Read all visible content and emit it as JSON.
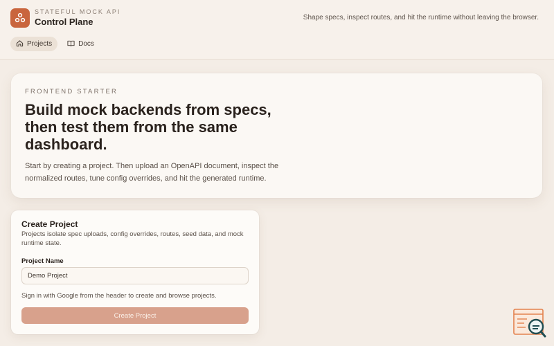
{
  "header": {
    "kicker": "STATEFUL MOCK API",
    "title": "Control Plane",
    "tagline": "Shape specs, inspect routes, and hit the runtime without leaving the browser.",
    "logo_icon": "network-nodes-icon"
  },
  "nav": {
    "items": [
      {
        "label": "Projects",
        "icon": "home-icon",
        "active": true
      },
      {
        "label": "Docs",
        "icon": "book-icon",
        "active": false
      }
    ]
  },
  "hero": {
    "kicker": "FRONTEND STARTER",
    "title": "Build mock backends from specs, then test them from the same dashboard.",
    "body": "Start by creating a project. Then upload an OpenAPI document, inspect the normalized routes, tune config overrides, and hit the generated runtime."
  },
  "create_project": {
    "title": "Create Project",
    "description": "Projects isolate spec uploads, config overrides, routes, seed data, and mock runtime state.",
    "name_label": "Project Name",
    "name_value": "Demo Project",
    "signin_note": "Sign in with Google from the header to create and browse projects.",
    "button_label": "Create Project"
  },
  "colors": {
    "accent": "#c9653d",
    "button_disabled": "#d8a18c",
    "background": "#f4ede6"
  }
}
